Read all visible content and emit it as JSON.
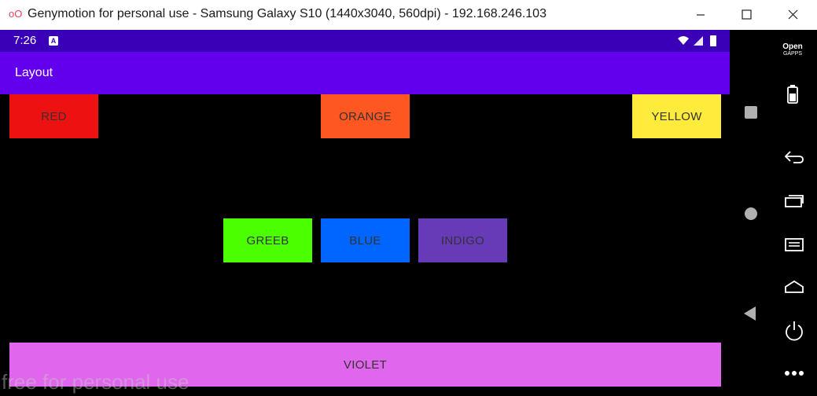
{
  "window": {
    "title": "Genymotion for personal use - Samsung Galaxy S10 (1440x3040, 560dpi) - 192.168.246.103",
    "logo_glyph": "oO"
  },
  "statusbar": {
    "time": "7:26",
    "notification_glyph": "A",
    "background": "#3a00b8"
  },
  "appbar": {
    "title": "Layout",
    "background": "#6200ee"
  },
  "buttons": {
    "red": {
      "label": "RED",
      "color": "#ee1111"
    },
    "orange": {
      "label": "ORANGE",
      "color": "#ff5722"
    },
    "yellow": {
      "label": "YELLOW",
      "color": "#ffeb3b"
    },
    "green": {
      "label": "GREEB",
      "color": "#4cff00"
    },
    "blue": {
      "label": "BLUE",
      "color": "#0066ff"
    },
    "indigo": {
      "label": "INDIGO",
      "color": "#673ab7"
    },
    "violet": {
      "label": "VIOLET",
      "color": "#e066ee"
    }
  },
  "watermark": "free for personal use",
  "side_panel": {
    "open_gapps_line1": "Open",
    "open_gapps_line2": "GAPPS",
    "icons": [
      "battery-icon",
      "square-icon",
      "back-icon",
      "recents-icon",
      "circle-icon",
      "menu-icon",
      "home-icon",
      "triangle-back-icon",
      "power-icon",
      "more-icon"
    ]
  }
}
